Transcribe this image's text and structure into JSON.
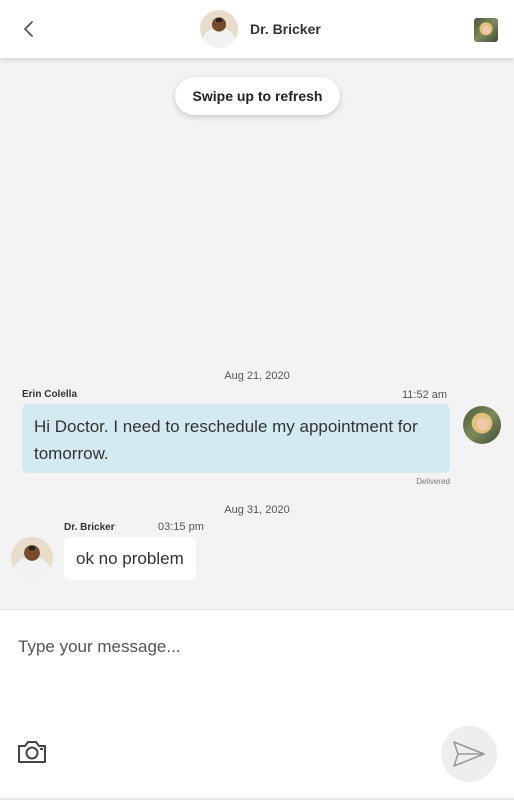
{
  "header": {
    "title": "Dr. Bricker",
    "back_icon": "chevron-left-icon"
  },
  "refresh": {
    "label": "Swipe up to refresh"
  },
  "messages": [
    {
      "date": "Aug 21, 2020",
      "sender": "Erin Colella",
      "time": "11:52 am",
      "text": "Hi Doctor. I need to reschedule my appointment for tomorrow.",
      "status": "Delivered",
      "direction": "outgoing"
    },
    {
      "date": "Aug 31, 2020",
      "sender": "Dr. Bricker",
      "time": "03:15 pm",
      "text": "ok no problem",
      "direction": "incoming"
    }
  ],
  "composer": {
    "placeholder": "Type your message...",
    "camera_icon": "camera-icon",
    "send_icon": "send-icon"
  },
  "colors": {
    "outgoing_bubble": "#d4eaf2",
    "incoming_bubble": "#ffffff",
    "background": "#f3f3f3"
  }
}
